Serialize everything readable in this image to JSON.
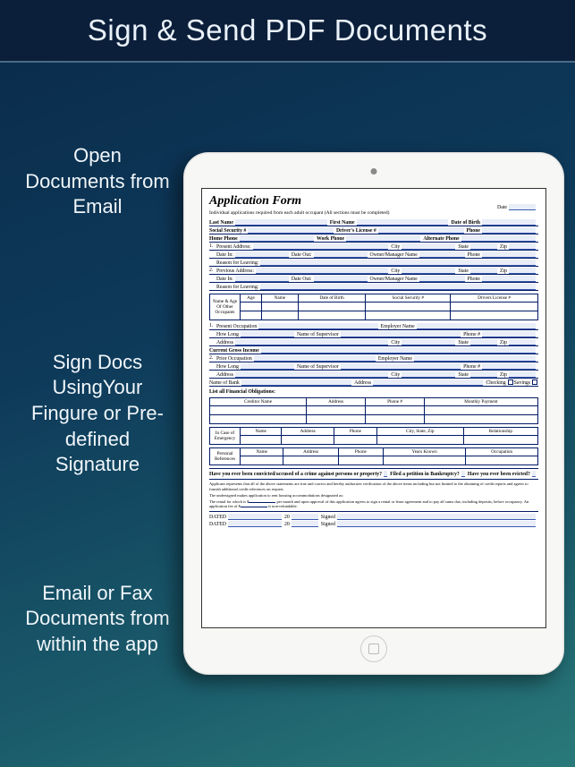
{
  "header": {
    "title": "Sign & Send PDF Documents"
  },
  "captions": {
    "c1": "Open Documents from Email",
    "c2": "Sign Docs UsingYour Fingure or Pre-defined Signature",
    "c3": "Email or Fax Documents from within the app"
  },
  "form": {
    "title": "Application Form",
    "subtitle": "Individual applications required from each adult occupant (All sections must be completed)",
    "date_lbl": "Date",
    "last_name": "Last Name",
    "first_name": "First Name",
    "dob": "Date of Birth",
    "ssn": "Social Security #",
    "dl": "Driver's License #",
    "phone_lbl": "Phone",
    "home_phone": "Home Phone",
    "work_phone": "Work Phone",
    "alt_phone": "Alternate Phone",
    "present_addr": "Present Address:",
    "previous_addr": "Previous Address:",
    "city": "City",
    "state": "State",
    "zip": "Zip",
    "date_in": "Date In:",
    "date_out": "Date Out:",
    "owner_mgr": "Owner/Manager Name",
    "reason_leaving": "Reason for Leaving:",
    "occupants_lbl": "Name & Age Of Other Occupants",
    "th_age": "Age",
    "th_name": "Name",
    "th_dob": "Date of Birth",
    "th_ssn": "Social Security #",
    "th_dl": "Drivers License #",
    "present_occ": "Present Occupation",
    "prior_occ": "Prior Occupation",
    "employer": "Employer Name",
    "how_long": "How Long",
    "supervisor": "Name of Supervisor",
    "phone_num": "Phone #",
    "address": "Address",
    "cgi": "Current Gross Income",
    "bank": "Name of Bank",
    "checking": "Checking",
    "savings": "Savings",
    "obligations": "List all Financial Obligations:",
    "th_creditor": "Creditor Name",
    "th_address": "Address",
    "th_phone": "Phone #",
    "th_payment": "Monthly Payment",
    "emergency": "In Case of Emergency",
    "references": "Personal References",
    "th_csz": "City, State, Zip",
    "th_rel": "Relationship",
    "th_occ": "Occupation",
    "conviction_q": "Have you ever been convicted/accused of a crime against persons or property?",
    "bankruptcy_q": "Filed a petition in Bankruptcy?",
    "evicted_q": "Have you ever been evicted?",
    "disclaimer1": "Applicant represents that all of the above statements are true and correct and hereby authorizes verification of the above items including but not limited to the obtaining of credit reports and agrees to furnish additional credit references on request.",
    "disclaimer2": "The undersigned makes application to rent housing accommodations designated as:",
    "disclaimer3a": "The rental for which is $",
    "disclaimer3b": "per month and upon approval of this application agrees to sign a rental or lease agreement and to pay all sums due, including deposits, before occupancy. An application fee of $",
    "disclaimer3c": "is non-refundable.",
    "dated": "DATED",
    "signed": "Signed",
    "n1": "1.",
    "n2": "2.",
    "twenty": "20"
  }
}
